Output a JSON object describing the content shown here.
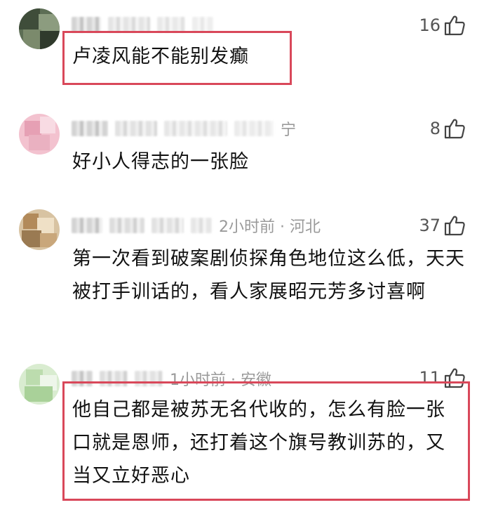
{
  "comments": [
    {
      "meta_text": "",
      "likes": "16",
      "text": "卢凌风能不能别发癫",
      "highlighted": true
    },
    {
      "meta_text": "宁",
      "likes": "8",
      "text": "好小人得志的一张脸",
      "highlighted": false
    },
    {
      "meta_text": "2小时前 · 河北",
      "likes": "37",
      "text": "第一次看到破案剧侦探角色地位这么低，天天被打手训话的，看人家展昭元芳多讨喜啊",
      "highlighted": false
    },
    {
      "meta_text": "1小时前 · 安徽",
      "likes": "11",
      "text": "他自己都是被苏无名代收的，怎么有脸一张口就是恩师，还打着这个旗号教训苏的，又当又立好恶心",
      "highlighted": true
    }
  ],
  "colors": {
    "highlight_border": "#d9485a",
    "meta_gray": "#9a9a9a"
  },
  "icons": {
    "like": "thumbs-up-icon"
  }
}
